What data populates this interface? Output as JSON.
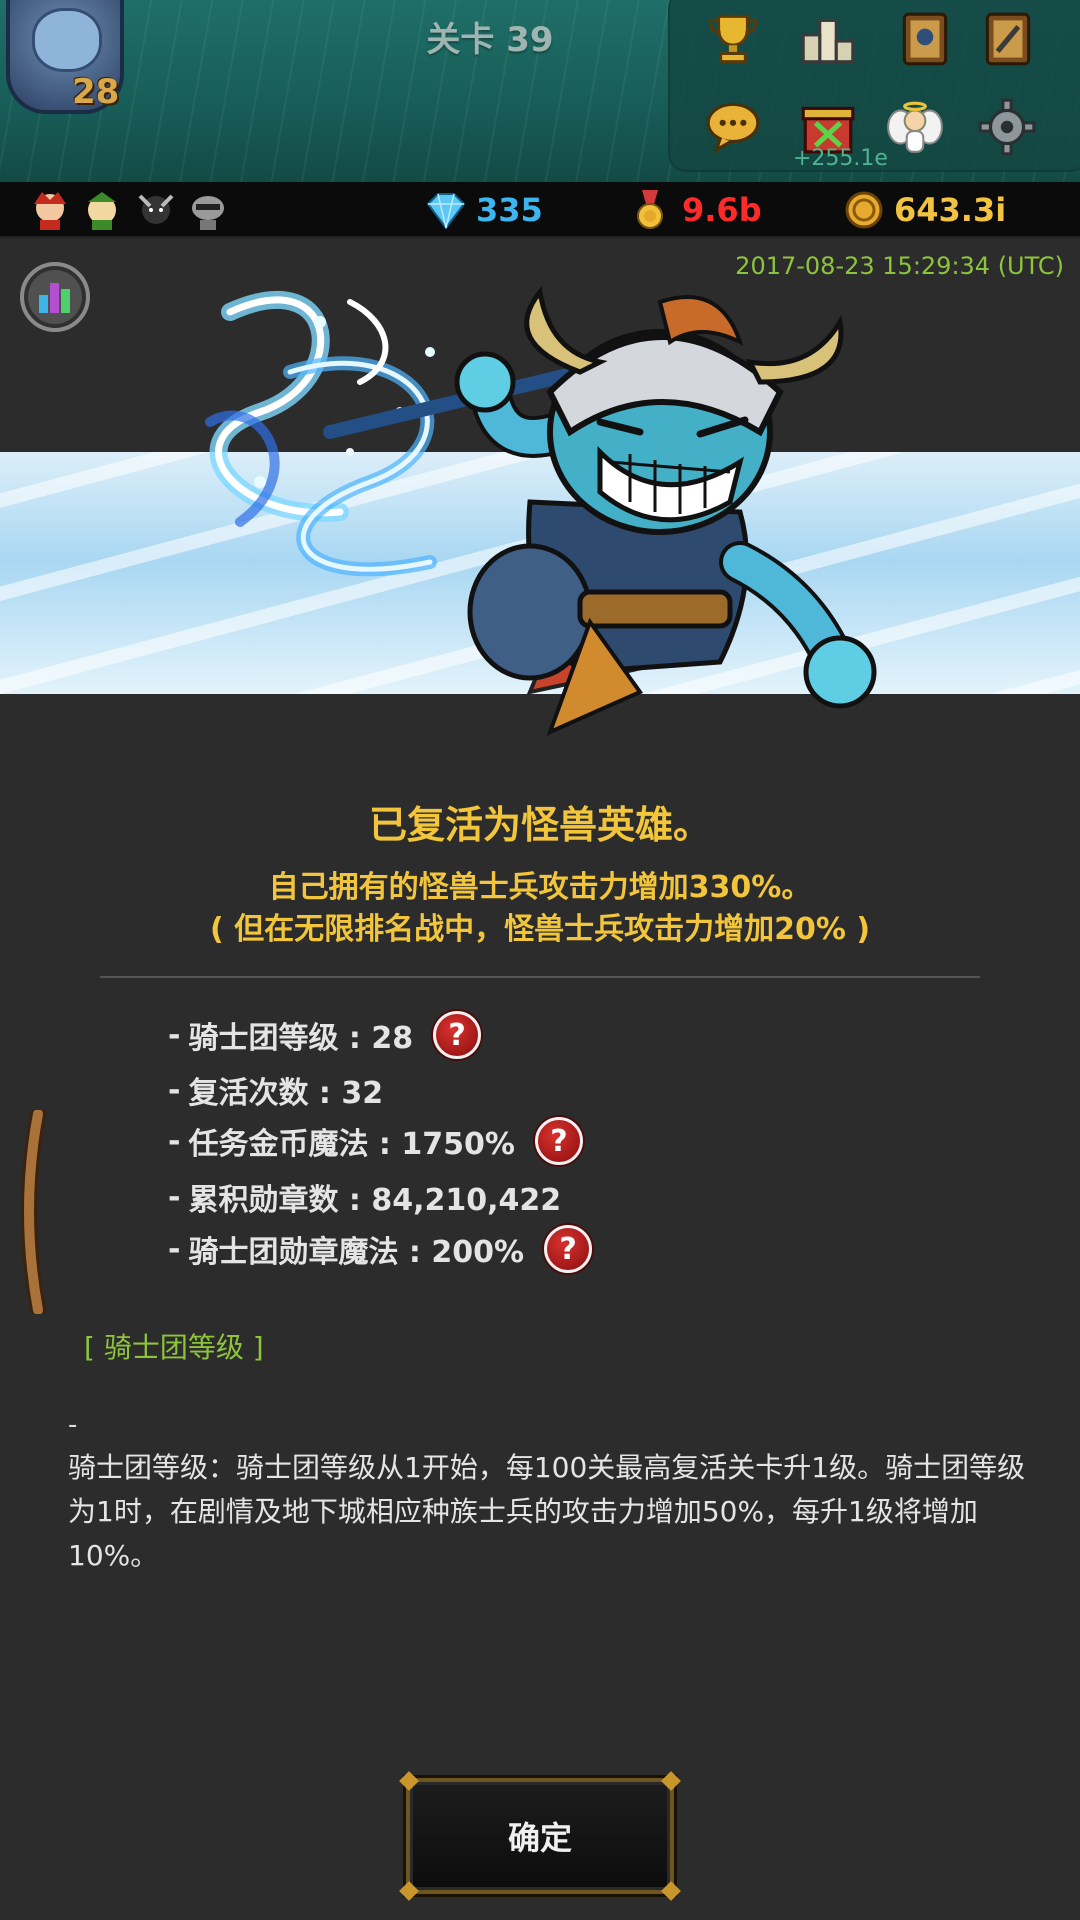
{
  "hud": {
    "stage_title": "关卡 39",
    "player_level": "28",
    "gain_label": "+255.1e",
    "icons": [
      "trophy-icon",
      "podium-icon",
      "book-icon",
      "sword-book-icon",
      "chat-icon",
      "gift-box-icon",
      "angel-icon",
      "gear-icon"
    ]
  },
  "resources": {
    "gems": "335",
    "medals": "9.6b",
    "gold": "643.3i",
    "colors": {
      "gems": "#3bb6f0",
      "medals": "#ff2b2b",
      "gold": "#f1c340"
    }
  },
  "panel": {
    "timestamp": "2017-08-23 15:29:34 (UTC)",
    "revive_title": "已复活为怪兽英雄。",
    "bonus_line_1": "自己拥有的怪兽士兵攻击力增加330%。",
    "bonus_line_2": "( 但在无限排名战中，怪兽士兵攻击力增加20% )",
    "stats": [
      {
        "dash": "-",
        "label": "骑士团等级 : 28",
        "has_help": true
      },
      {
        "dash": "-",
        "label": "复活次数 : 32",
        "has_help": false
      },
      {
        "dash": "-",
        "label": "任务金币魔法 : 1750%",
        "has_help": true
      },
      {
        "dash": "-",
        "label": "累积勋章数 : 84,210,422",
        "has_help": false
      },
      {
        "dash": "-",
        "label": "骑士团勋章魔法 : 200%",
        "has_help": true
      }
    ],
    "help_glyph": "?",
    "section_heading": "[ 骑士团等级 ]",
    "desc_dash": "-",
    "description": "骑士团等级：骑士团等级从1开始，每100关最高复活关卡升1级。骑士团等级为1时，在剧情及地下城相应种族士兵的攻击力增加50%，每升1级将增加10%。",
    "confirm_label": "确定"
  }
}
